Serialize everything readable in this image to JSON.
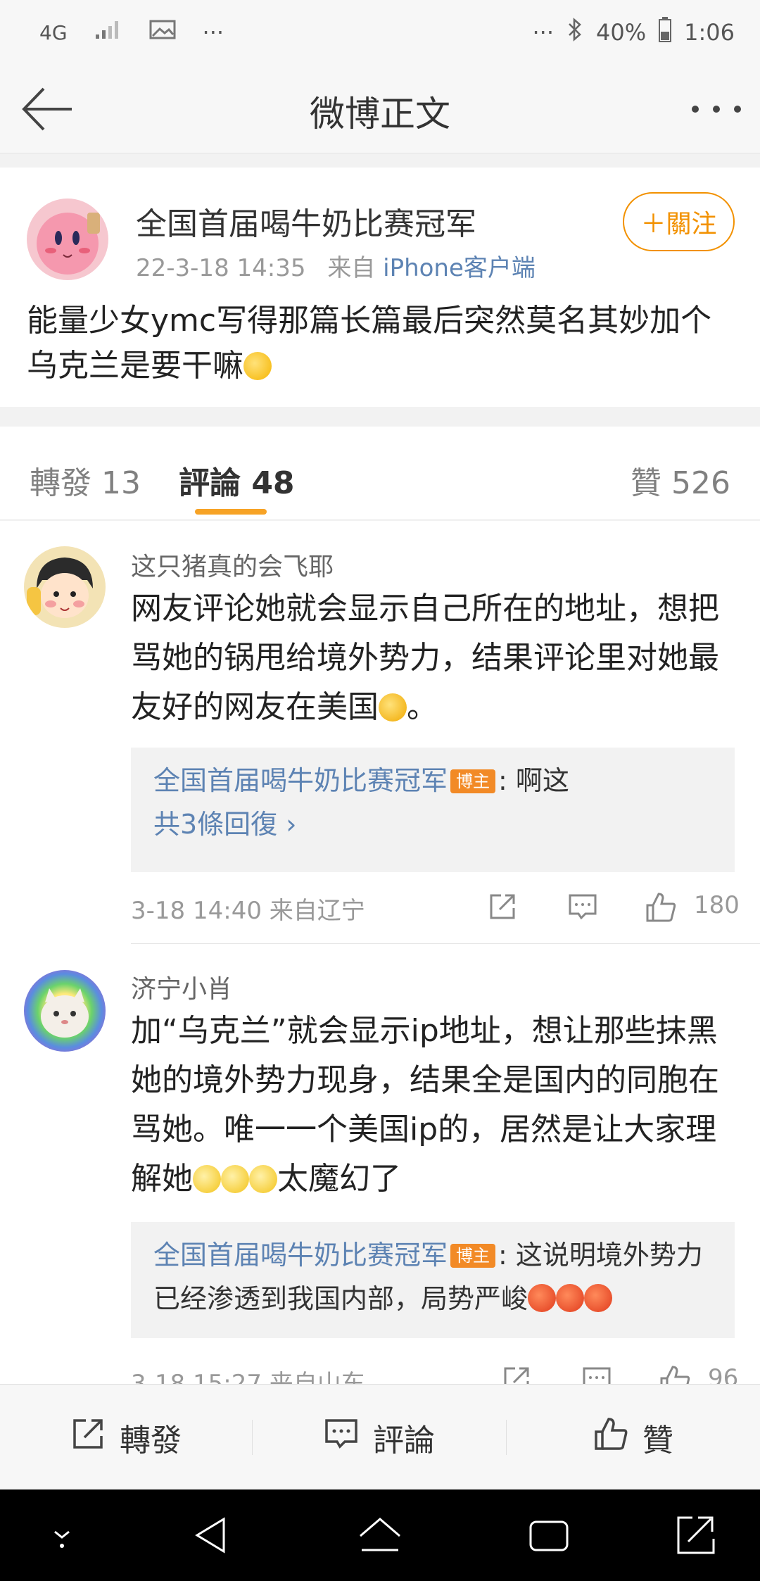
{
  "status_bar": {
    "network": "4G",
    "more_left": "···",
    "more_right": "···",
    "battery": "40%",
    "time": "1:06"
  },
  "nav": {
    "title": "微博正文"
  },
  "post": {
    "author": "全国首届喝牛奶比赛冠军",
    "time": "22-3-18 14:35",
    "from_label": "来自",
    "source": "iPhone客户端",
    "follow_label": "＋關注",
    "text": "能量少女ymc写得那篇长篇最后突然莫名其妙加个乌克兰是要干嘛",
    "emoji": "thinking-face"
  },
  "tabs": {
    "reposts": "轉發 13",
    "comments": "評論 48",
    "likes": "贊 526"
  },
  "comments": [
    {
      "name": "这只猪真的会飞耶",
      "text": "网友评论她就会显示自己所在的地址，想把骂她的锅甩给境外势力，结果评论里对她最友好的网友在美国",
      "text_end": "。",
      "reply_author": "全国首届喝牛奶比赛冠军",
      "badge": "博主",
      "reply_text": ": 啊这",
      "reply_more": "共3條回復 ›",
      "time": "3-18 14:40  来自辽宁",
      "likes": "180"
    },
    {
      "name": "济宁小肖",
      "text": "加“乌克兰”就会显示ip地址，想让那些抹黑她的境外势力现身，结果全是国内的同胞在骂她。唯一一个美国ip的，居然是让大家理解她",
      "text_end": "太魔幻了",
      "reply_author": "全国首届喝牛奶比赛冠军",
      "badge": "博主",
      "reply_text": ": 这说明境外势力已经渗透到我国内部，局势严峻",
      "time": "3-18 15:27  来自山东",
      "likes": "96"
    }
  ],
  "toolbar": {
    "repost": "轉發",
    "comment": "評論",
    "like": "贊"
  },
  "colors": {
    "accent": "#f29100",
    "link": "#5d83b3",
    "tab_indicator": "#f7a326",
    "badge": "#f28a26"
  }
}
